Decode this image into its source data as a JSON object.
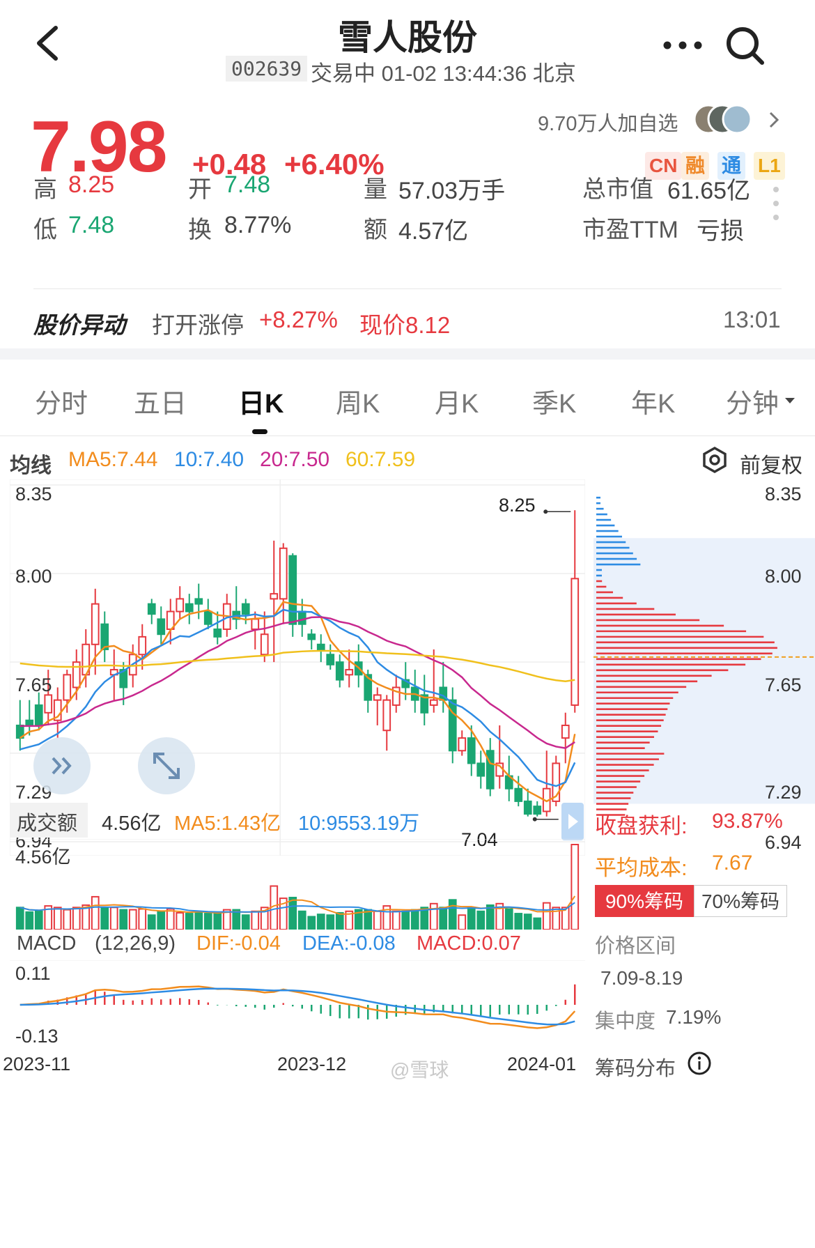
{
  "header": {
    "title": "雪人股份",
    "code": "002639",
    "status_line": "交易中 01-02 13:44:36 北京"
  },
  "quote": {
    "price": "7.98",
    "change": "+0.48",
    "change_pct": "+6.40%",
    "followers": "9.70万人加自选",
    "badges": [
      "CN",
      "融",
      "通",
      "L1"
    ],
    "stats": {
      "high_label": "高",
      "high": "8.25",
      "open_label": "开",
      "open": "7.48",
      "volume_label": "量",
      "volume": "57.03万手",
      "mcap_label": "总市值",
      "mcap": "61.65亿",
      "low_label": "低",
      "low": "7.48",
      "turnover_label": "换",
      "turnover": "8.77%",
      "amount_label": "额",
      "amount": "4.57亿",
      "pe_label": "市盈TTM",
      "pe": "亏损"
    },
    "alert": {
      "title": "股价异动",
      "text": "打开涨停",
      "pct": "+8.27%",
      "now": "现价8.12",
      "time": "13:01"
    }
  },
  "tabs": [
    "分时",
    "五日",
    "日K",
    "周K",
    "月K",
    "季K",
    "年K",
    "分钟"
  ],
  "ma": {
    "label": "均线",
    "ma5": "MA5:7.44",
    "ma10": "10:7.40",
    "ma20": "20:7.50",
    "ma60": "60:7.59",
    "adjust": "前复权"
  },
  "price_axis": {
    "left": [
      "8.35",
      "8.00",
      "7.65",
      "7.29",
      "6.94"
    ],
    "right": [
      "8.35",
      "8.00",
      "7.65",
      "7.29",
      "6.94"
    ],
    "hi": "8.25",
    "lo": "7.04"
  },
  "volume": {
    "label": "成交额",
    "value": "4.56亿",
    "ma5": "MA5:1.43亿",
    "ma10": "10:9553.19万",
    "axis": "4.56亿"
  },
  "macd": {
    "label": "MACD",
    "params": "(12,26,9)",
    "dif": "DIF:-0.04",
    "dea": "DEA:-0.08",
    "macd": "MACD:0.07",
    "axis_hi": "0.11",
    "axis_lo": "-0.13"
  },
  "dates": [
    "2023-11",
    "2023-12",
    "2024-01"
  ],
  "chips": {
    "profit_label": "收盘获利:",
    "profit": "93.87%",
    "cost_label": "平均成本:",
    "cost": "7.67",
    "tab90": "90%筹码",
    "tab70": "70%筹码",
    "range_label": "价格区间",
    "range": "7.09-8.19",
    "conc_label": "集中度",
    "conc": "7.19%",
    "footer": "筹码分布"
  },
  "watermark": "@雪球",
  "colors": {
    "up": "#e6393f",
    "down": "#1aa672",
    "ma5": "#f28c1d",
    "ma10": "#2d8be3",
    "ma20": "#c8288e",
    "ma60": "#f0c01c"
  },
  "chart_data": {
    "type": "candlestick",
    "title": "",
    "xlabel": "",
    "ylabel": "",
    "ylim": [
      6.94,
      8.35
    ],
    "x": [
      "2023-11",
      "2023-12",
      "2024-01"
    ],
    "candles": [
      [
        7.4,
        7.35,
        7.5,
        7.3
      ],
      [
        7.42,
        7.4,
        7.5,
        7.36
      ],
      [
        7.48,
        7.4,
        7.53,
        7.38
      ],
      [
        7.45,
        7.52,
        7.62,
        7.4
      ],
      [
        7.42,
        7.5,
        7.55,
        7.35
      ],
      [
        7.5,
        7.6,
        7.62,
        7.45
      ],
      [
        7.55,
        7.65,
        7.7,
        7.5
      ],
      [
        7.6,
        7.72,
        7.78,
        7.55
      ],
      [
        7.72,
        7.88,
        7.94,
        7.6
      ],
      [
        7.8,
        7.7,
        7.85,
        7.65
      ],
      [
        7.6,
        7.62,
        7.7,
        7.5
      ],
      [
        7.62,
        7.55,
        7.65,
        7.48
      ],
      [
        7.6,
        7.68,
        7.72,
        7.55
      ],
      [
        7.68,
        7.75,
        7.8,
        7.62
      ],
      [
        7.88,
        7.84,
        7.9,
        7.8
      ],
      [
        7.82,
        7.76,
        7.87,
        7.72
      ],
      [
        7.78,
        7.85,
        7.9,
        7.72
      ],
      [
        7.85,
        7.9,
        7.95,
        7.82
      ],
      [
        7.88,
        7.85,
        7.92,
        7.8
      ],
      [
        7.9,
        7.88,
        7.96,
        7.82
      ],
      [
        7.85,
        7.8,
        7.9,
        7.78
      ],
      [
        7.78,
        7.75,
        7.85,
        7.72
      ],
      [
        7.78,
        7.88,
        7.92,
        7.75
      ],
      [
        7.85,
        7.82,
        7.95,
        7.78
      ],
      [
        7.88,
        7.84,
        7.9,
        7.8
      ],
      [
        7.78,
        7.82,
        7.85,
        7.7
      ],
      [
        7.68,
        7.76,
        7.85,
        7.65
      ],
      [
        7.9,
        7.92,
        8.13,
        7.65
      ],
      [
        7.9,
        8.1,
        8.12,
        7.8
      ],
      [
        8.07,
        7.8,
        8.08,
        7.75
      ],
      [
        7.85,
        7.8,
        7.9,
        7.75
      ],
      [
        7.76,
        7.74,
        7.78,
        7.7
      ],
      [
        7.72,
        7.7,
        7.76,
        7.65
      ],
      [
        7.68,
        7.64,
        7.72,
        7.62
      ],
      [
        7.65,
        7.58,
        7.68,
        7.55
      ],
      [
        7.6,
        7.62,
        7.7,
        7.55
      ],
      [
        7.65,
        7.6,
        7.72,
        7.55
      ],
      [
        7.6,
        7.5,
        7.62,
        7.45
      ],
      [
        7.5,
        7.52,
        7.55,
        7.4
      ],
      [
        7.38,
        7.5,
        7.52,
        7.3
      ],
      [
        7.48,
        7.55,
        7.6,
        7.45
      ],
      [
        7.58,
        7.55,
        7.65,
        7.5
      ],
      [
        7.55,
        7.5,
        7.62,
        7.45
      ],
      [
        7.52,
        7.45,
        7.6,
        7.4
      ],
      [
        7.48,
        7.5,
        7.7,
        7.45
      ],
      [
        7.55,
        7.5,
        7.65,
        7.45
      ],
      [
        7.5,
        7.3,
        7.55,
        7.25
      ],
      [
        7.3,
        7.35,
        7.38,
        7.28
      ],
      [
        7.35,
        7.25,
        7.4,
        7.2
      ],
      [
        7.25,
        7.2,
        7.3,
        7.15
      ],
      [
        7.3,
        7.15,
        7.35,
        7.12
      ],
      [
        7.2,
        7.25,
        7.4,
        7.15
      ],
      [
        7.2,
        7.15,
        7.28,
        7.1
      ],
      [
        7.15,
        7.1,
        7.2,
        7.08
      ],
      [
        7.1,
        7.05,
        7.15,
        7.04
      ],
      [
        7.08,
        7.05,
        7.1,
        7.04
      ],
      [
        7.06,
        7.15,
        7.3,
        7.04
      ],
      [
        7.1,
        7.25,
        7.28,
        7.08
      ],
      [
        7.35,
        7.4,
        7.45,
        7.25
      ],
      [
        7.48,
        7.98,
        8.25,
        7.45
      ]
    ],
    "series": [
      {
        "name": "MA5"
      },
      {
        "name": "MA10"
      },
      {
        "name": "MA20"
      },
      {
        "name": "MA60"
      }
    ]
  }
}
